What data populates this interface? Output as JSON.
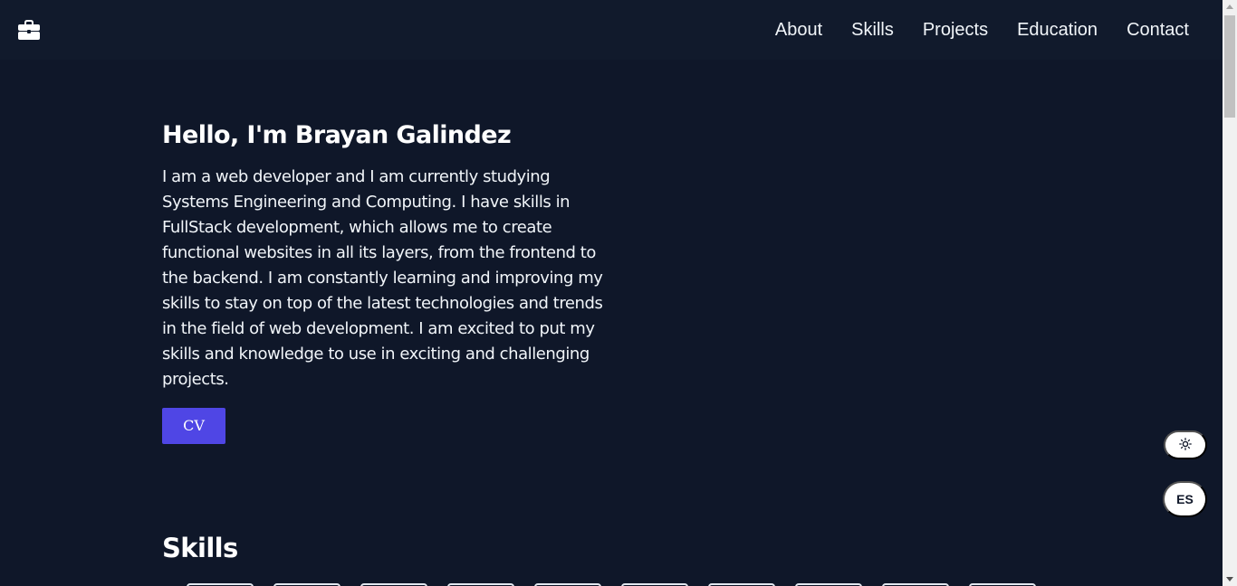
{
  "nav": {
    "logo_icon": "briefcase-icon",
    "links": [
      "About",
      "Skills",
      "Projects",
      "Education",
      "Contact"
    ]
  },
  "hero": {
    "title": "Hello, I'm Brayan Galindez",
    "description": "I am a web developer and I am currently studying Systems Engineering and Computing. I have skills in FullStack development, which allows me to create functional websites in all its layers, from the frontend to the backend. I am constantly learning and improving my skills to stay on top of the latest technologies and trends in the field of web development. I am excited to put my skills and knowledge to use in exciting and challenging projects.",
    "cv_label": "CV"
  },
  "skills": {
    "title": "Skills"
  },
  "controls": {
    "theme_icon": "sun-icon",
    "language_label": "ES"
  },
  "colors": {
    "background": "#0f1729",
    "navbar": "#111a2c",
    "accent": "#4f46e5",
    "text": "#f1f5f9"
  }
}
